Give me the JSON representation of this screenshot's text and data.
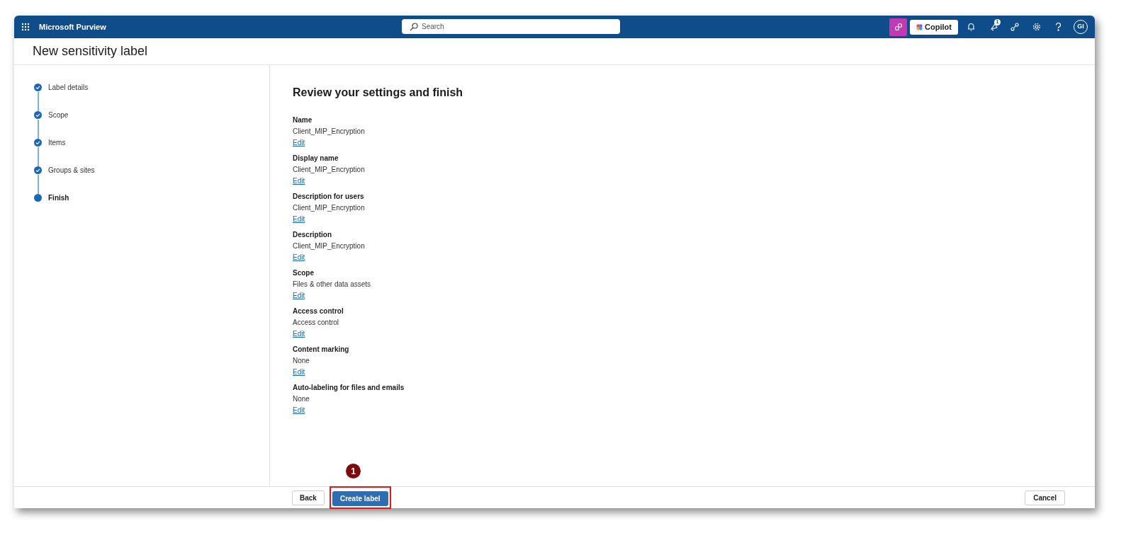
{
  "header": {
    "app_title": "Microsoft Purview",
    "search": {
      "placeholder": "Search"
    },
    "copilot": "Copilot",
    "notification_count": "1",
    "avatar": "GI"
  },
  "page_title": "New sensitivity label",
  "steps": [
    {
      "label": "Label details",
      "completed": true,
      "selected": false
    },
    {
      "label": "Scope",
      "completed": true,
      "selected": false
    },
    {
      "label": "Items",
      "completed": true,
      "selected": false
    },
    {
      "label": "Groups & sites",
      "completed": true,
      "selected": false
    },
    {
      "label": "Finish",
      "completed": false,
      "selected": true
    }
  ],
  "review": {
    "title": "Review your settings and finish",
    "sections": [
      {
        "heading": "Name",
        "value": "Client_MIP_Encryption",
        "link": "Edit"
      },
      {
        "heading": "Display name",
        "value": "Client_MIP_Encryption",
        "link": "Edit"
      },
      {
        "heading": "Description for users",
        "value": "Client_MIP_Encryption",
        "link": "Edit"
      },
      {
        "heading": "Description",
        "value": "Client_MIP_Encryption",
        "link": "Edit"
      },
      {
        "heading": "Scope",
        "value": "Files & other data assets",
        "link": "Edit"
      },
      {
        "heading": "Access control",
        "value": "Access control",
        "link": "Edit"
      },
      {
        "heading": "Content marking",
        "value": "None",
        "link": "Edit"
      },
      {
        "heading": "Auto-labeling for files and emails",
        "value": "None",
        "link": "Edit"
      }
    ]
  },
  "footer": {
    "back": "Back",
    "create": "Create label",
    "cancel": "Cancel"
  },
  "annotation": {
    "number": "1"
  }
}
